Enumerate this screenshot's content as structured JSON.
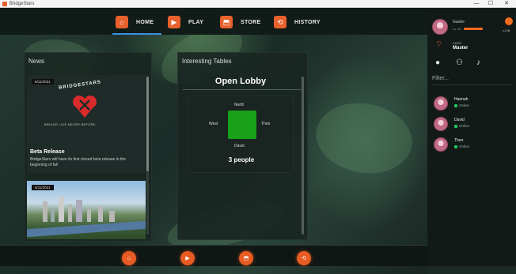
{
  "window": {
    "title": "BridgeStars",
    "controls": [
      "—",
      "☐",
      "✕"
    ]
  },
  "nav": {
    "items": [
      {
        "label": "HOME",
        "icon": "home-icon",
        "color": "#e8612c"
      },
      {
        "label": "PLAY",
        "icon": "play-icon",
        "color": "#e8612c"
      },
      {
        "label": "STORE",
        "icon": "store-icon",
        "color": "#e8612c"
      },
      {
        "label": "HISTORY",
        "icon": "history-icon",
        "color": "#e8612c"
      }
    ],
    "active": "HOME"
  },
  "news": {
    "title": "News",
    "post1": {
      "date": "6/11/2021",
      "brand": "BRIDGESTARS",
      "tagline": "BRIDGE LIKE NEVER BEFORE",
      "headline": "Beta Release",
      "body": "BridgeStars will have its first closed beta release in the beginning of fal!"
    },
    "post2": {
      "date": "6/11/2021"
    }
  },
  "tables": {
    "title": "Interesting Tables",
    "lobby": "Open Lobby",
    "seats": {
      "north": "North",
      "west": "West",
      "east": "Theo",
      "south": "David"
    },
    "people": "3 people"
  },
  "dock": {
    "buttons": [
      "home-icon",
      "play-icon",
      "store-icon",
      "history-icon"
    ]
  },
  "sidebar": {
    "user": {
      "name": "Gaster",
      "rank": "Lv. 34",
      "coins": "x1.5k"
    },
    "level": {
      "label": "Level",
      "value": "Master"
    },
    "filter_placeholder": "Filter...",
    "friends": [
      {
        "name": "Hannah",
        "status": "Online"
      },
      {
        "name": "David",
        "status": "Online"
      },
      {
        "name": "Theo",
        "status": "Online"
      }
    ]
  },
  "colors": {
    "accent": "#e8612c",
    "online": "#22c55e",
    "felt": "#1aa11a",
    "nav_underline": "#3c8ee8"
  }
}
